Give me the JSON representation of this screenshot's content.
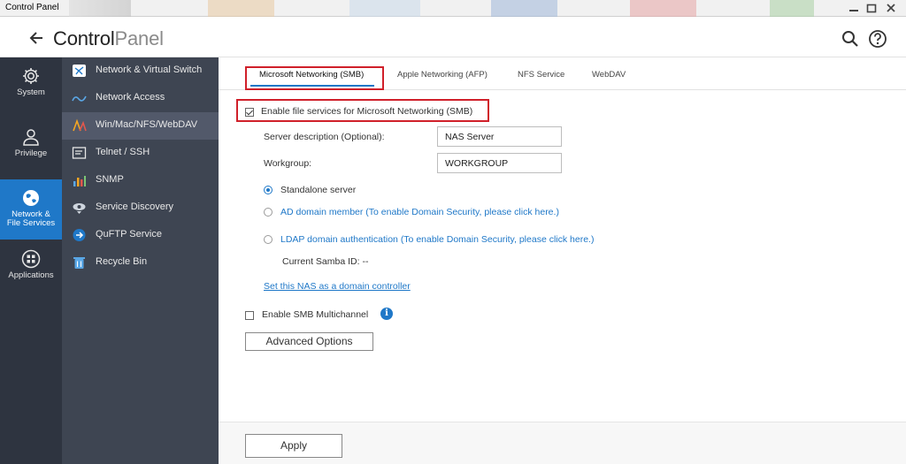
{
  "window": {
    "title": "Control Panel"
  },
  "header": {
    "title_bold": "Control",
    "title_light": "Panel"
  },
  "icons": {
    "back": "arrow-left-icon",
    "search": "search-icon",
    "help": "help-icon",
    "minimize": "minimize-icon",
    "maximize": "maximize-icon",
    "close": "close-icon"
  },
  "rail": {
    "items": [
      {
        "label": "System",
        "icon": "gear-icon"
      },
      {
        "label": "Privilege",
        "icon": "user-icon"
      },
      {
        "label_line1": "Network &",
        "label_line2": "File Services",
        "icon": "globe-icon",
        "active": true
      },
      {
        "label": "Applications",
        "icon": "apps-grid-icon"
      }
    ]
  },
  "subnav": {
    "items": [
      {
        "label": "Network & Virtual Switch",
        "icon": "network-switch-icon"
      },
      {
        "label": "Network Access",
        "icon": "network-access-icon"
      },
      {
        "label": "Win/Mac/NFS/WebDAV",
        "icon": "file-services-icon",
        "active": true
      },
      {
        "label": "Telnet / SSH",
        "icon": "terminal-icon"
      },
      {
        "label": "SNMP",
        "icon": "snmp-icon"
      },
      {
        "label": "Service Discovery",
        "icon": "service-discovery-icon"
      },
      {
        "label": "QuFTP Service",
        "icon": "ftp-icon"
      },
      {
        "label": "Recycle Bin",
        "icon": "recycle-bin-icon"
      }
    ]
  },
  "tabs": [
    {
      "label": "Microsoft Networking (SMB)",
      "active": true
    },
    {
      "label": "Apple Networking (AFP)"
    },
    {
      "label": "NFS Service"
    },
    {
      "label": "WebDAV"
    }
  ],
  "form": {
    "enable_smb": {
      "label": "Enable file services for Microsoft Networking (SMB)",
      "checked": true
    },
    "server_description": {
      "label": "Server description (Optional):",
      "value": "NAS Server"
    },
    "workgroup": {
      "label": "Workgroup:",
      "value": "WORKGROUP"
    },
    "radios": [
      {
        "label": "Standalone server",
        "selected": true
      },
      {
        "label": "AD domain member (To enable Domain Security, please click here.)",
        "selected": false
      },
      {
        "label": "LDAP domain authentication (To enable Domain Security, please click here.)",
        "selected": false
      }
    ],
    "samba_id": "Current Samba ID: --",
    "domain_controller_link": "Set this NAS as a domain controller",
    "smb_multichannel": {
      "label": "Enable SMB Multichannel",
      "checked": false
    },
    "advanced_button": "Advanced Options",
    "info_glyph": "i"
  },
  "footer": {
    "apply": "Apply"
  },
  "colors": {
    "accent": "#1f78c8",
    "highlight": "#d0202a",
    "rail_bg": "#2e3440",
    "subnav_bg": "#3e4552"
  }
}
